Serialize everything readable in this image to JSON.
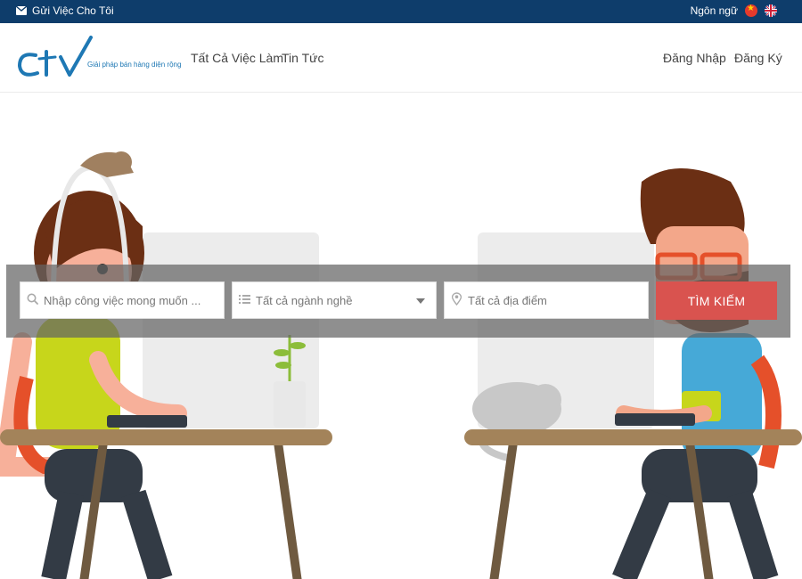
{
  "topbar": {
    "send_job_label": "Gửi Việc Cho Tôi",
    "language_label": "Ngôn ngữ"
  },
  "header": {
    "logo_mark": "CTV",
    "logo_tagline": "Giải pháp bán hàng diện rộng",
    "nav": {
      "all_jobs": "Tất Cả Việc Làm",
      "news": "Tin Tức",
      "login": "Đăng Nhập",
      "register": "Đăng Ký"
    }
  },
  "search": {
    "keyword_placeholder": "Nhập công việc mong muốn ...",
    "category_value": "Tất cả ngành nghề",
    "location_placeholder": "Tất cả địa điểm",
    "submit_label": "TÌM KIẾM"
  },
  "colors": {
    "topbar": "#0e3d6b",
    "brand": "#1e78b4",
    "search_button": "#d9534f"
  }
}
